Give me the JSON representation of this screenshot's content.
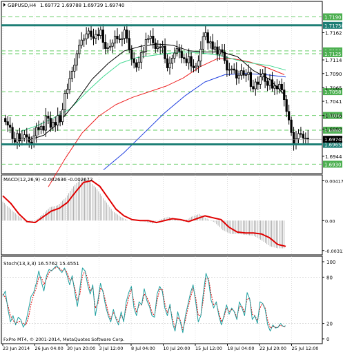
{
  "colors": {
    "background": "#ffffff",
    "frame": "#000000",
    "grid": "#c0c0c0",
    "candle": "#000000",
    "level_line": "#1d7f75",
    "level_label_green": "#4caf50",
    "level_dash": "#66cc66",
    "ma_black": "#000000",
    "ma_lightgreen": "#40d890",
    "ma_red": "#ee2020",
    "ma_blue": "#2040e0",
    "ma_green_short": "#00b000",
    "macd_line": "#e00000",
    "histogram": "#a0a0a0",
    "stoch_main": "#20a0a0",
    "stoch_signal": "#e00000",
    "price_label_bg": "#000000",
    "price_label_fg": "#ffffff"
  },
  "chart_data": [
    {
      "type": "candlestick",
      "title": "GBPUSD,H4",
      "ohlc_header": "1.69772 1.69788 1.69739 1.69740",
      "ylim": [
        1.6922,
        1.721
      ],
      "yticks": [
        "1.7162",
        "1.7114",
        "1.7090",
        "1.7065",
        "1.7041",
        "1.7016",
        "1.6992",
        "1.6944"
      ],
      "green_level_labels": [
        "1.7190",
        "1.7130",
        "1.7125",
        "1.7058",
        "1.7016",
        "1.6990",
        "1.6930"
      ],
      "x_categories": [
        "23 Jun 2014",
        "26 Jun 04:00",
        "30 Jun 20:00",
        "3 Jul 12:00",
        "8 Jul 04:00",
        "10 Jul 20:00",
        "15 Jul 12:00",
        "18 Jul 04:00",
        "22 Jul 20:00",
        "25 Jul 12:00"
      ],
      "horizontal_levels": [
        {
          "value": 1.7175,
          "label": "1.71750"
        },
        {
          "value": 1.6965,
          "label": "1.69650"
        }
      ],
      "current_price": {
        "value": 1.6974,
        "label": "1.69740"
      },
      "series": [
        {
          "name": "close",
          "values": [
            1.7005,
            1.6999,
            1.6995,
            1.6975,
            1.6969,
            1.6984,
            1.6971,
            1.6976,
            1.6982,
            1.6978,
            1.6969,
            1.6965,
            1.698,
            1.6995,
            1.6991,
            1.6997,
            1.699,
            1.7015,
            1.7011,
            1.6995,
            1.7004,
            1.6999,
            1.7016,
            1.7005,
            1.7026,
            1.7055,
            1.7062,
            1.7081,
            1.7094,
            1.7105,
            1.7125,
            1.714,
            1.7149,
            1.7151,
            1.716,
            1.7165,
            1.7155,
            1.7152,
            1.7159,
            1.7157,
            1.7167,
            1.7145,
            1.7134,
            1.7136,
            1.7138,
            1.7144,
            1.7156,
            1.7151,
            1.715,
            1.7152,
            1.7167,
            1.7152,
            1.7132,
            1.7116,
            1.7109,
            1.7101,
            1.711,
            1.7127,
            1.7129,
            1.715,
            1.7152,
            1.7156,
            1.7144,
            1.7134,
            1.7137,
            1.7136,
            1.7138,
            1.7116,
            1.71,
            1.7108,
            1.7117,
            1.7126,
            1.7134,
            1.7129,
            1.7118,
            1.7116,
            1.7109,
            1.712,
            1.7103,
            1.71,
            1.7103,
            1.7112,
            1.7133,
            1.7155,
            1.7162,
            1.7144,
            1.7146,
            1.7133,
            1.7137,
            1.7124,
            1.7132,
            1.7128,
            1.7113,
            1.7096,
            1.7097,
            1.7098,
            1.7096,
            1.7082,
            1.7087,
            1.7095,
            1.7087,
            1.7088,
            1.7092,
            1.7067,
            1.7063,
            1.7075,
            1.7071,
            1.7084,
            1.709,
            1.7076,
            1.7069,
            1.7079,
            1.7064,
            1.7068,
            1.7063,
            1.7071,
            1.7061,
            1.7044,
            1.7023,
            1.7008,
            1.6986,
            1.6966,
            1.6975,
            1.6984,
            1.6983,
            1.6976,
            1.6976,
            1.6974
          ]
        },
        {
          "name": "ma_black",
          "values": [
            1.6972,
            1.6981,
            1.7005,
            1.704,
            1.708,
            1.7108,
            1.713,
            1.7138,
            1.7142,
            1.714,
            1.713,
            1.7128,
            1.7128,
            1.712,
            1.7095,
            1.708,
            1.705
          ]
        },
        {
          "name": "ma_lightgreen",
          "values": [
            1.6988,
            1.6998,
            1.7012,
            1.7028,
            1.7058,
            1.7085,
            1.7108,
            1.7118,
            1.7122,
            1.7126,
            1.7128,
            1.7126,
            1.7122,
            1.7114,
            1.7108,
            1.7104,
            1.7096
          ]
        },
        {
          "name": "ma_red",
          "values": [
            1.689,
            1.694,
            1.6985,
            1.7015,
            1.7035,
            1.7048,
            1.7058,
            1.7068,
            1.7082,
            1.7102,
            1.7116,
            1.7116,
            1.711,
            1.71,
            1.7088
          ]
        },
        {
          "name": "ma_blue",
          "values": [
            1.692,
            1.695,
            1.6985,
            1.702,
            1.705,
            1.7075,
            1.7088,
            1.709,
            1.7088,
            1.7084
          ]
        }
      ]
    },
    {
      "type": "line",
      "title": "MACD(12,26,9) -0.002636 -0.002672",
      "ylim": [
        -0.0033,
        0.0045
      ],
      "yticks": [
        "0.004175",
        "0.00",
        "-0.003138"
      ],
      "series": [
        {
          "name": "signal",
          "values": [
            0.0026,
            0.0018,
            0.0007,
            -0.0001,
            -0.0002,
            0.0004,
            0.001,
            0.0013,
            0.0019,
            0.003,
            0.004,
            0.0042,
            0.0036,
            0.0024,
            0.0012,
            0.0005,
            0.0001,
            0.0,
            0.0,
            -0.0002,
            0.0,
            0.0002,
            0.0001,
            -0.0001,
            0.0002,
            0.0005,
            0.0003,
            0.0001,
            -0.0007,
            -0.0012,
            -0.0013,
            -0.0013,
            -0.0014,
            -0.0018,
            -0.0025,
            -0.0027
          ]
        },
        {
          "name": "histogram",
          "values": [
            0.002,
            0.0012,
            0.0005,
            -0.0002,
            -0.0001,
            0.0006,
            0.0014,
            0.0016,
            0.0024,
            0.0036,
            0.0044,
            0.0042,
            0.0033,
            0.0021,
            0.001,
            0.0004,
            0.0,
            0.0001,
            -0.0001,
            -0.0003,
            0.0001,
            0.0004,
            0.0002,
            -0.0001,
            0.0004,
            0.0007,
            0.0002,
            -0.0002,
            -0.001,
            -0.0014,
            -0.0014,
            -0.0015,
            -0.0016,
            -0.0021,
            -0.0027,
            -0.0029
          ]
        }
      ]
    },
    {
      "type": "line",
      "title": "Stoch(13,3,3) 16.5762 15.4551",
      "ylim": [
        0,
        100
      ],
      "yticks": [
        "100",
        "80",
        "20",
        "0"
      ],
      "series": [
        {
          "name": "main",
          "values": [
            55,
            62,
            38,
            22,
            30,
            18,
            28,
            25,
            15,
            22,
            38,
            55,
            60,
            72,
            88,
            74,
            62,
            82,
            90,
            88,
            92,
            95,
            90,
            86,
            92,
            82,
            70,
            82,
            60,
            42,
            66,
            92,
            88,
            70,
            58,
            70,
            30,
            50,
            72,
            60,
            42,
            30,
            22,
            38,
            26,
            18,
            35,
            22,
            48,
            60,
            68,
            40,
            30,
            48,
            44,
            65,
            50,
            42,
            30,
            28,
            58,
            68,
            62,
            40,
            30,
            45,
            20,
            10,
            35,
            22,
            8,
            30,
            45,
            60,
            70,
            48,
            22,
            30,
            60,
            85,
            75,
            50,
            40,
            48,
            30,
            18,
            30,
            44,
            32,
            40,
            35,
            25,
            48,
            40,
            30,
            60,
            52,
            25,
            30,
            20,
            48,
            46,
            38,
            18,
            10,
            18,
            14,
            15,
            20,
            16,
            17
          ]
        },
        {
          "name": "signal",
          "values": [
            58,
            54,
            43,
            30,
            24,
            20,
            22,
            23,
            20,
            18,
            28,
            45,
            57,
            66,
            80,
            80,
            70,
            78,
            86,
            89,
            91,
            93,
            92,
            88,
            90,
            86,
            76,
            78,
            66,
            50,
            58,
            82,
            88,
            78,
            62,
            66,
            40,
            46,
            66,
            62,
            48,
            34,
            26,
            34,
            28,
            22,
            30,
            25,
            40,
            54,
            64,
            48,
            34,
            44,
            44,
            58,
            54,
            46,
            34,
            30,
            50,
            64,
            64,
            46,
            34,
            42,
            26,
            14,
            28,
            24,
            12,
            24,
            40,
            54,
            66,
            54,
            30,
            30,
            52,
            78,
            78,
            58,
            44,
            46,
            34,
            22,
            28,
            40,
            35,
            38,
            36,
            28,
            42,
            42,
            34,
            52,
            52,
            32,
            30,
            24,
            40,
            46,
            40,
            24,
            14,
            16,
            15,
            15,
            18,
            16,
            15
          ]
        }
      ]
    }
  ],
  "footer": {
    "copyright": "FxPro MT4, © 2001-2014, MetaQuotes Software Corp."
  }
}
